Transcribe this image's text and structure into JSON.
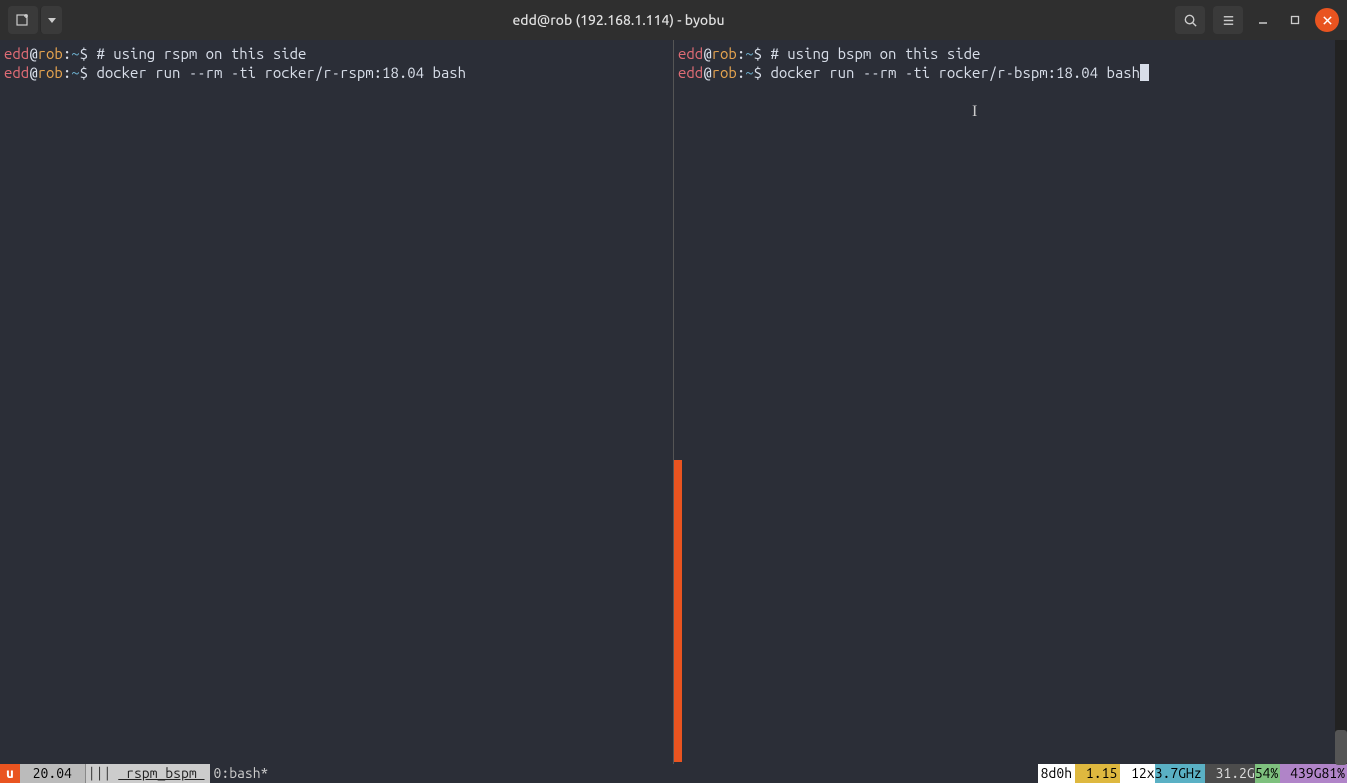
{
  "titlebar": {
    "title": "edd@rob (192.168.1.114) - byobu"
  },
  "panes": {
    "left": {
      "line1_user": "edd",
      "line1_at": "@",
      "line1_host": "rob",
      "line1_colon": ":",
      "line1_path": "~",
      "line1_dollar": "$ ",
      "line1_cmd": "# using rspm on this side",
      "line2_user": "edd",
      "line2_at": "@",
      "line2_host": "rob",
      "line2_colon": ":",
      "line2_path": "~",
      "line2_dollar": "$ ",
      "line2_cmd": "docker run --rm -ti rocker/r-rspm:18.04 bash"
    },
    "right": {
      "line1_user": "edd",
      "line1_at": "@",
      "line1_host": "rob",
      "line1_colon": ":",
      "line1_path": "~",
      "line1_dollar": "$ ",
      "line1_cmd": "# using bspm on this side",
      "line2_user": "edd",
      "line2_at": "@",
      "line2_host": "rob",
      "line2_colon": ":",
      "line2_path": "~",
      "line2_dollar": "$ ",
      "line2_cmd": "docker run --rm -ti rocker/r-bspm:18.04 bash"
    }
  },
  "statusbar": {
    "logo": "u",
    "release": " 20.04 ",
    "menu": "|||",
    "session": " rspm_bspm ",
    "window": "0:bash*",
    "uptime": "8d0h",
    "load": " 1.15",
    "cores_n": " 12",
    "cores_x": "x",
    "freq": "3.7GHz",
    "temp_n": " 31.2",
    "temp_unit": "G",
    "mem_pct": "54%",
    "disk_n": " 439",
    "disk_unit": "G",
    "disk_pct": "81%"
  }
}
